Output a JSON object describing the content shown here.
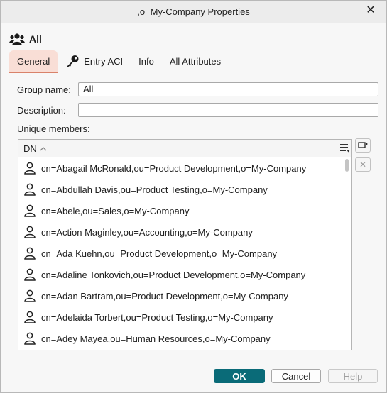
{
  "window": {
    "title": ",o=My-Company Properties"
  },
  "header": {
    "label": "All",
    "icon": "group-icon"
  },
  "tabs": [
    {
      "label": "General",
      "active": true
    },
    {
      "label": "Entry ACI",
      "icon": "key-icon"
    },
    {
      "label": "Info"
    },
    {
      "label": "All Attributes"
    }
  ],
  "form": {
    "group_name_label": "Group name:",
    "group_name_value": "All",
    "description_label": "Description:",
    "description_value": "",
    "members_label": "Unique members:"
  },
  "table": {
    "column_header": "DN",
    "rows": [
      "cn=Abagail McRonald,ou=Product Development,o=My-Company",
      "cn=Abdullah Davis,ou=Product Testing,o=My-Company",
      "cn=Abele,ou=Sales,o=My-Company",
      "cn=Action Maginley,ou=Accounting,o=My-Company",
      "cn=Ada Kuehn,ou=Product Development,o=My-Company",
      "cn=Adaline Tonkovich,ou=Product Development,o=My-Company",
      "cn=Adan Bartram,ou=Product Development,o=My-Company",
      "cn=Adelaida Torbert,ou=Product Testing,o=My-Company",
      "cn=Adey Mayea,ou=Human Resources,o=My-Company"
    ]
  },
  "buttons": {
    "ok": "OK",
    "cancel": "Cancel",
    "help": "Help"
  },
  "colors": {
    "accent": "#0a6b78",
    "tab_active_bg": "#f9ded6",
    "tab_underline": "#d9826a"
  }
}
